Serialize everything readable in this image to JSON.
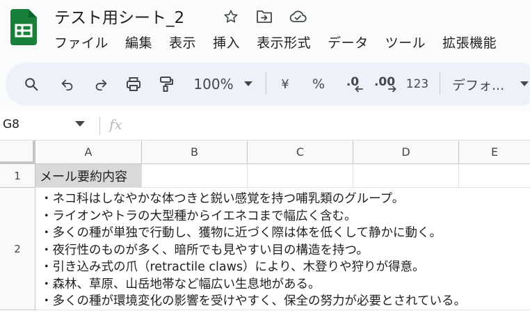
{
  "app": {
    "doc_title": "テスト用シート_2",
    "brand_color": "#188038"
  },
  "title_icons": [
    "star-icon",
    "move-to-folder-icon",
    "cloud-status-icon"
  ],
  "menu": {
    "items": [
      "ファイル",
      "編集",
      "表示",
      "挿入",
      "表示形式",
      "データ",
      "ツール",
      "拡張機能"
    ]
  },
  "toolbar": {
    "zoom": "100%",
    "currency": "¥",
    "percent": "%",
    "decimal_decrease": ".0",
    "decimal_increase": ".00",
    "number_format": "123",
    "font": "デフォ..."
  },
  "formula_bar": {
    "cell_ref": "G8",
    "fx_label": "fx",
    "value": ""
  },
  "grid": {
    "columns": [
      "A",
      "B",
      "C",
      "D",
      "E"
    ],
    "rows": [
      "1",
      "2"
    ],
    "a1": "メール要約内容",
    "a2_lines": [
      "・ネコ科はしなやかな体つきと鋭い感覚を持つ哺乳類のグループ。",
      "・ライオンやトラの大型種からイエネコまで幅広く含む。",
      "・多くの種が単独で行動し、獲物に近づく際は体を低くして静かに動く。",
      "・夜行性のものが多く、暗所でも見やすい目の構造を持つ。",
      "・引き込み式の爪（retractile claws）により、木登りや狩りが得意。",
      "・森林、草原、山岳地帯など幅広い生息地がある。",
      "・多くの種が環境変化の影響を受けやすく、保全の努力が必要とされている。"
    ]
  }
}
